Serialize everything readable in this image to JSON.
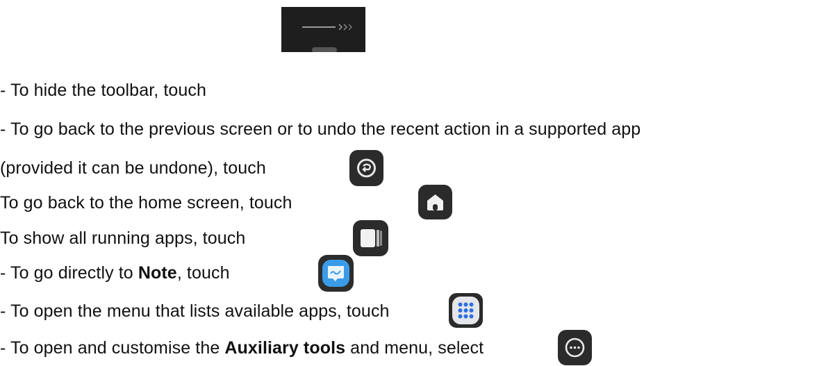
{
  "instructions": [
    {
      "id": "hide-toolbar",
      "text": "- To hide the toolbar, touch",
      "icon": "toolbar-collapse-icon"
    },
    {
      "id": "back",
      "text": "- To go back to the previous screen or to undo the recent action in a supported app"
    },
    {
      "id": "back-cont",
      "text": "(provided it can be undone), touch",
      "icon": "back-undo-icon"
    },
    {
      "id": "home",
      "text": " To go back to the home screen, touch",
      "icon": "home-icon"
    },
    {
      "id": "recents",
      "text": " To show all running apps, touch",
      "icon": "recent-apps-icon"
    },
    {
      "id": "note",
      "text_before": "- To go directly to ",
      "bold": "Note",
      "text_after": ", touch",
      "icon": "note-app-icon"
    },
    {
      "id": "apps-menu",
      "text": "- To open the menu that lists available apps, touch",
      "icon": "apps-grid-icon"
    },
    {
      "id": "aux",
      "text_before": "- To open and customise the ",
      "bold": "Auxiliary tools",
      "text_after": " and menu, select",
      "icon": "more-options-icon"
    }
  ],
  "colors": {
    "text": "#111111",
    "icon_dark_bg": "#2b2b2b",
    "note_blue": "#3a9be8",
    "apps_light_bg": "#e4e6ea",
    "apps_dots": "#2f6ee0"
  }
}
